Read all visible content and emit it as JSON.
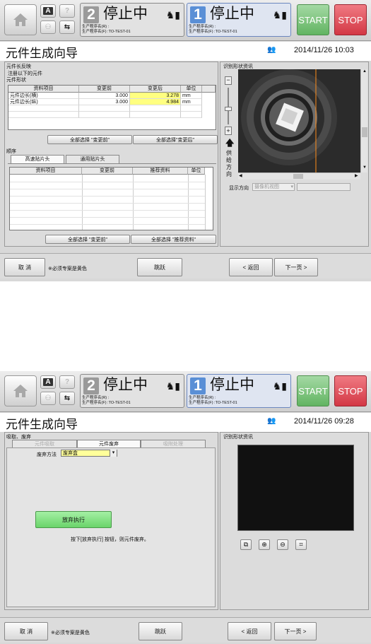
{
  "screen1": {
    "header": {
      "line2": {
        "number": "2",
        "status": "停止中",
        "prog_info": "生产程序名(R) :\n生产程序名(F) :TO-TEST-01"
      },
      "line1": {
        "number": "1",
        "status": "停止中",
        "prog_info": "生产程序名(R) :\n生产程序名(F) :TO-TEST-01"
      },
      "small_buttons": [
        "A",
        "?"
      ],
      "start_label": "START",
      "stop_label": "STOP"
    },
    "title": "元件生成向导",
    "datetime": "2014/11/26 10:03",
    "left": {
      "group_label": "元件长反映",
      "instruction": "注册以下的元件",
      "shape_label": "元件形状",
      "shape_table": {
        "headers": [
          "资料项目",
          "变更前",
          "变更后",
          "单位"
        ],
        "rows": [
          [
            "元件边长(横)",
            "3.000",
            "3.278",
            "mm"
          ],
          [
            "元件边长(纵)",
            "3.000",
            "4.984",
            "mm"
          ]
        ]
      },
      "select_before_label": "全部选择 \"变更前\"",
      "select_after_label": "全部选择\"变更后\"",
      "order_label": "顺序",
      "tabs": [
        "高速贴片头",
        "通用贴片头"
      ],
      "order_table": {
        "headers": [
          "资料项目",
          "变更前",
          "推荐资料",
          "单位"
        ]
      },
      "select_before2_label": "全部选择 \"变更前\"",
      "select_recommended_label": "全部选择 \"推荐资料\""
    },
    "right": {
      "group_label": "识别形状资讯",
      "feed_dir_label": "供\n给\n方\n向",
      "display_dir_label": "显示方向",
      "display_dir_value": "摄像机视图"
    },
    "footer": {
      "cancel_label": "取 消",
      "required_note": "※必须专案是黄色",
      "skip_label": "跳跃",
      "back_label": "< 返回",
      "next_label": "下一页 >"
    }
  },
  "screen2": {
    "header": {
      "line2": {
        "number": "2",
        "status": "停止中",
        "prog_info": "生产程序名(R) :\n生产程序名(F) :TO-TEST-01"
      },
      "line1": {
        "number": "1",
        "status": "停止中",
        "prog_info": "生产程序名(R) :\n生产程序名(F) :TO-TEST-01"
      },
      "small_buttons": [
        "A",
        "?"
      ],
      "start_label": "START",
      "stop_label": "STOP"
    },
    "title": "元件生成向导",
    "datetime": "2014/11/26 09:28",
    "left": {
      "group_label": "吸取、废弃",
      "tabs": [
        "元件吸取",
        "元件废弃",
        "吸附处理"
      ],
      "discard_method_label": "废弃方法",
      "discard_method_value": "废弃盒",
      "execute_label": "放弃执行",
      "instruction": "按下[放弃执行] 按钮，则元件废弃。"
    },
    "right": {
      "group_label": "识别形状资讯"
    },
    "footer": {
      "cancel_label": "取 消",
      "required_note": "※必须专案是黄色",
      "skip_label": "跳跃",
      "back_label": "< 返回",
      "next_label": "下一页 >"
    },
    "colors": {
      "execute_button": "#7ee87e",
      "camera_bg": "#111111"
    }
  }
}
